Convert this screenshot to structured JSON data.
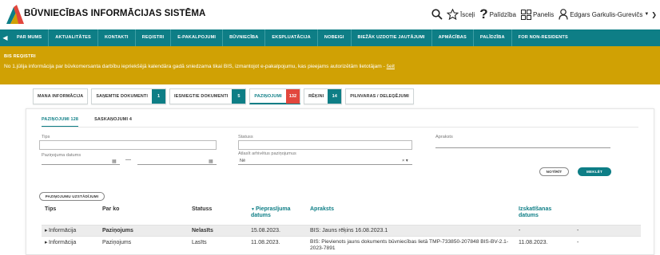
{
  "header": {
    "title": "BŪVNIECĪBAS INFORMĀCIJAS SISTĒMA",
    "actions": [
      {
        "icon": "search-icon",
        "label": ""
      },
      {
        "icon": "star-icon",
        "label": "Īsceļi"
      },
      {
        "icon": "help-icon",
        "label": "Palīdzība"
      },
      {
        "icon": "panels-icon",
        "label": "Panelis"
      },
      {
        "icon": "user-icon",
        "label": "Edgars Garkulis-Gurevičs"
      }
    ]
  },
  "nav": {
    "items": [
      "PAR MUMS",
      "AKTUALITĀTES",
      "KONTAKTI",
      "REĢISTRI",
      "E-PAKALPOJUMI",
      "BŪVNIECĪBA",
      "EKSPLUATĀCIJA",
      "NOBEIGI",
      "BIEŽĀK UZDOTIE JAUTĀJUMI",
      "APMĀCĪBAS",
      "PALĪDZĪBA",
      "FOR NON-RESIDENTS"
    ]
  },
  "notice": {
    "title": "BIS REĢISTRI",
    "text": "No 1.jūlija informācija par būvkomersanta darbību iepriekšējā kalendāra gadā sniedzama tikai BIS, izmantojot e-pakalpojumu, kas pieejams autorizētām lietotājam -",
    "link": "šeit"
  },
  "type_tabs": [
    {
      "label": "MANA INFORMĀCIJA",
      "count": ""
    },
    {
      "label": "SAŅEMTIE DOKUMENTI",
      "count": "1"
    },
    {
      "label": "IESNIEGTIE DOKUMENTI",
      "count": "5"
    },
    {
      "label": "PAZIŅOJUMI",
      "count": "132"
    },
    {
      "label": "RĒĶINI",
      "count": "14"
    },
    {
      "label": "PILNVARAS / DELEĢĒJUMI",
      "count": ""
    }
  ],
  "subtabs": [
    {
      "label": "PAZIŅOJUMI 128"
    },
    {
      "label": "SASKAŅOJUMI 4"
    }
  ],
  "filters": {
    "tips_label": "Tips",
    "status_label": "Statuss",
    "apraksts_label": "Apraksts",
    "date_label": "Paziņojuma datums",
    "date_separator": "—",
    "atlasit_label": "Atlasīt arhivētus paziņojumus",
    "atlasit_value": "Nē",
    "clear_button": "NOTĪRĪT",
    "search_button": "MEKLĒT"
  },
  "table": {
    "settings_button": "PAZIŅOJUMU UZSTĀDĪJUMI",
    "columns": [
      "Tips",
      "Par ko",
      "Statuss",
      "Pieprasījuma datums",
      "Apraksts",
      "Izskatīšanas datums"
    ],
    "rows": [
      {
        "tips": "Informācija",
        "par_ko": "Paziņojums",
        "statuss": "Nelasīts",
        "datums": "15.08.2023.",
        "apraksts": "BIS: Jauns rēķins 16.08.2023.1",
        "izskatisanas": "-",
        "extra": "-"
      },
      {
        "tips": "Informācija",
        "par_ko": "Paziņojums",
        "statuss": "Lasīts",
        "datums": "11.08.2023.",
        "apraksts": "BIS: Pievienots jauns dokuments būvniecības lietā TMP-733850-207848 BIS-BV-2.1-2023-7891",
        "izskatisanas": "11.08.2023.",
        "extra": "-"
      }
    ]
  },
  "colors": {
    "teal": "#0e7e86",
    "gold": "#d0a104",
    "red": "#e2473d"
  }
}
